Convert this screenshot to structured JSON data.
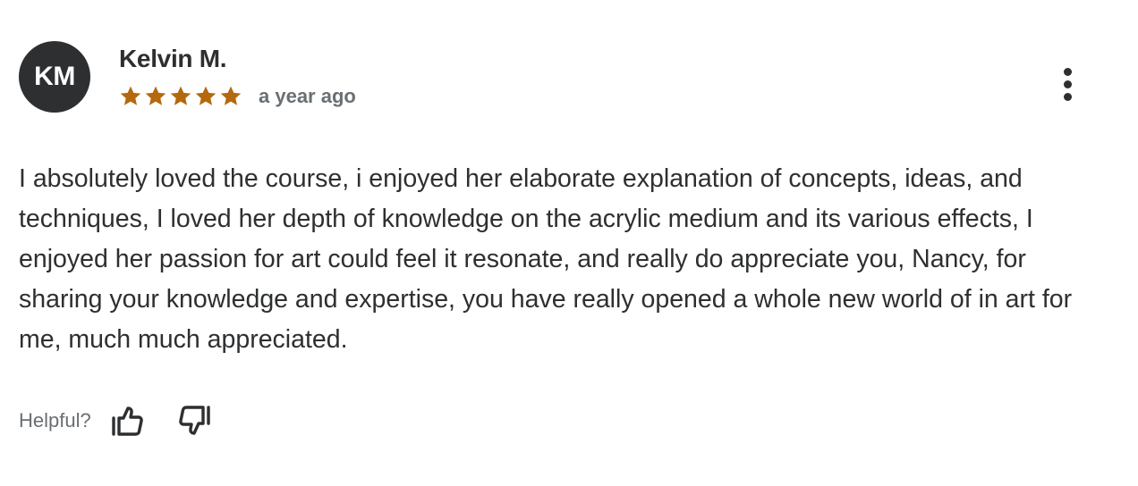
{
  "review": {
    "avatar_initials": "KM",
    "reviewer_name": "Kelvin M.",
    "rating": 5,
    "rating_max": 5,
    "date": "a year ago",
    "text": "I absolutely loved the course, i enjoyed her elaborate explanation of concepts, ideas, and techniques, I loved her depth of knowledge on the acrylic medium and its various effects, I enjoyed her passion for art could feel it resonate, and really do appreciate you, Nancy, for sharing your knowledge and expertise, you have really opened a whole new world of in art for me, much much appreciated."
  },
  "actions": {
    "helpful_label": "Helpful?",
    "thumb_up_icon": "thumbs-up-icon",
    "thumb_down_icon": "thumbs-down-icon",
    "menu_icon": "more-vertical-icon"
  },
  "colors": {
    "star": "#b4690e",
    "text": "#2d2f31",
    "muted": "#6a6f73",
    "avatar_bg": "#2d2f31"
  }
}
